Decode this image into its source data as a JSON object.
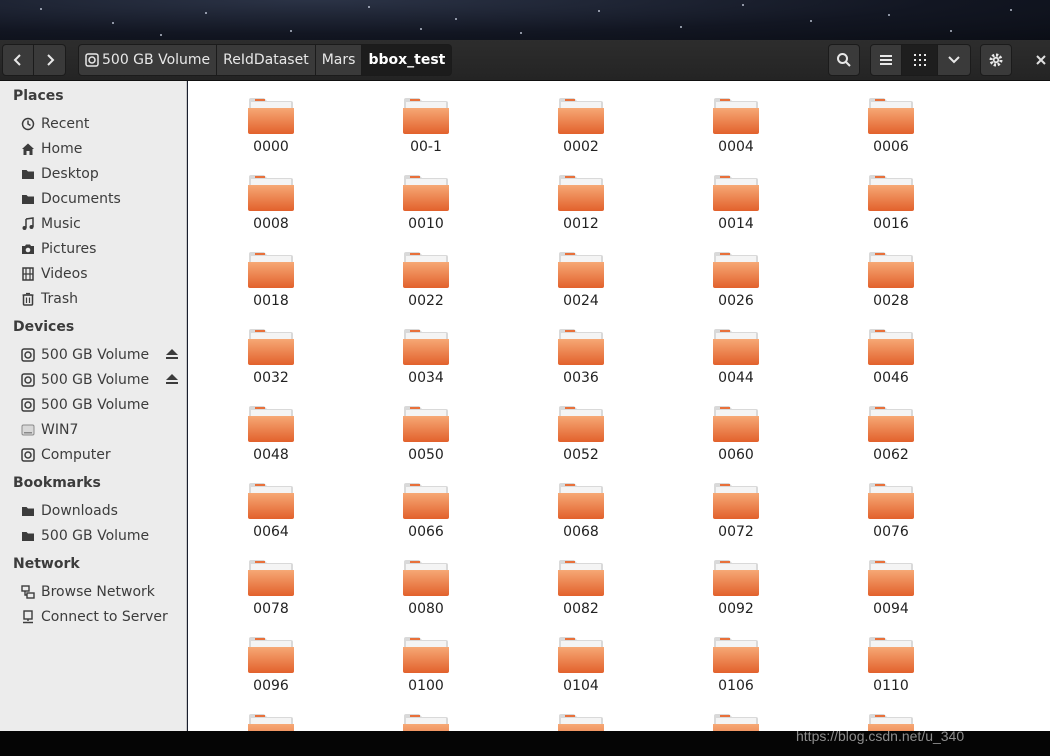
{
  "toolbar": {
    "back_icon": "chevron-left-icon",
    "forward_icon": "chevron-right-icon",
    "breadcrumbs": [
      "500 GB Volume",
      "ReIdDataset",
      "Mars",
      "bbox_test"
    ],
    "search_icon": "search-icon",
    "list_view_icon": "list-icon",
    "grid_view_icon": "grid-icon",
    "view_menu_icon": "chevron-down-icon",
    "settings_icon": "gear-icon",
    "close_icon": "close-icon"
  },
  "sidebar": {
    "sections": [
      {
        "title": "Places",
        "items": [
          "Recent",
          "Home",
          "Desktop",
          "Documents",
          "Music",
          "Pictures",
          "Videos",
          "Trash"
        ]
      },
      {
        "title": "Devices",
        "items": [
          "500 GB Volume",
          "500 GB Volume",
          "500 GB Volume",
          "WIN7",
          "Computer"
        ]
      },
      {
        "title": "Bookmarks",
        "items": [
          "Downloads",
          "500 GB Volume"
        ]
      },
      {
        "title": "Network",
        "items": [
          "Browse Network",
          "Connect to Server"
        ]
      }
    ]
  },
  "folders": [
    "0000",
    "00-1",
    "0002",
    "0004",
    "0006",
    "0008",
    "0010",
    "0012",
    "0014",
    "0016",
    "0018",
    "0022",
    "0024",
    "0026",
    "0028",
    "0032",
    "0034",
    "0036",
    "0044",
    "0046",
    "0048",
    "0050",
    "0052",
    "0060",
    "0062",
    "0064",
    "0066",
    "0068",
    "0072",
    "0076",
    "0078",
    "0080",
    "0082",
    "0092",
    "0094",
    "0096",
    "0100",
    "0104",
    "0106",
    "0110"
  ],
  "watermark": "https://blog.csdn.net/u_340",
  "colors": {
    "folder_orange": "#e8703a",
    "folder_light": "#f6a875",
    "headerbar": "#2d2d2d",
    "sidebar_bg": "#ececec"
  }
}
